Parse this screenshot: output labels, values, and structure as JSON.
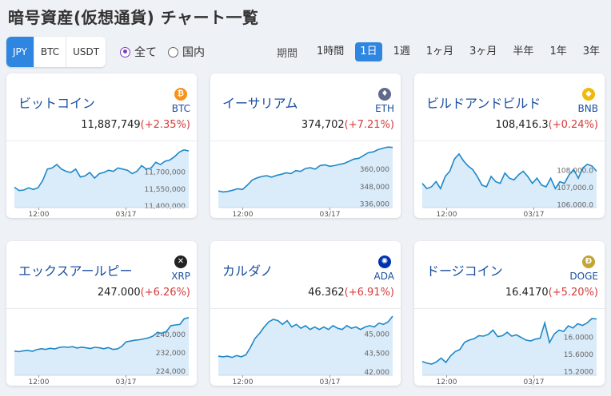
{
  "page_title": "暗号資産(仮想通貨) チャート一覧",
  "currency_tabs": [
    {
      "label": "JPY",
      "active": true
    },
    {
      "label": "BTC",
      "active": false
    },
    {
      "label": "USDT",
      "active": false
    }
  ],
  "filter_radios": [
    {
      "label": "全て",
      "checked": true
    },
    {
      "label": "国内",
      "checked": false
    }
  ],
  "period_label": "期間",
  "periods": [
    {
      "label": "1時間",
      "active": false
    },
    {
      "label": "1日",
      "active": true
    },
    {
      "label": "1週",
      "active": false
    },
    {
      "label": "1ヶ月",
      "active": false
    },
    {
      "label": "3ヶ月",
      "active": false
    },
    {
      "label": "半年",
      "active": false
    },
    {
      "label": "1年",
      "active": false
    },
    {
      "label": "3年",
      "active": false
    }
  ],
  "colors": {
    "accent": "#2f86e0",
    "line": "#1e88c8",
    "fill": "#d4e8f8",
    "change_up": "#d63b3b"
  },
  "cards": [
    {
      "name": "ビットコイン",
      "symbol": "BTC",
      "icon": "bitcoin-icon",
      "icon_color": "#f7931a",
      "icon_glyph": "₿",
      "price": "11,887,749",
      "change": "(+2.35%)",
      "chart_data": {
        "type": "area",
        "x_ticks": [
          "12:00",
          "03/17"
        ],
        "y_ticks": [
          "11,700,000",
          "11,550,000",
          "11,400,000"
        ],
        "ylim": [
          11380000,
          11930000
        ],
        "values": [
          11560000,
          11530000,
          11535000,
          11555000,
          11540000,
          11555000,
          11620000,
          11720000,
          11730000,
          11760000,
          11720000,
          11700000,
          11690000,
          11720000,
          11650000,
          11660000,
          11690000,
          11640000,
          11680000,
          11690000,
          11710000,
          11700000,
          11730000,
          11720000,
          11710000,
          11680000,
          11700000,
          11750000,
          11720000,
          11730000,
          11780000,
          11760000,
          11790000,
          11800000,
          11830000,
          11870000,
          11890000,
          11880000
        ]
      }
    },
    {
      "name": "イーサリアム",
      "symbol": "ETH",
      "icon": "ethereum-icon",
      "icon_color": "#5f6b8a",
      "icon_glyph": "♦",
      "price": "374,702",
      "change": "(+7.21%)",
      "chart_data": {
        "type": "area",
        "x_ticks": [
          "12:00",
          "03/17"
        ],
        "y_ticks": [
          "360,000",
          "348,000",
          "336,000"
        ],
        "ylim": [
          333000,
          376000
        ],
        "values": [
          344500,
          343800,
          344200,
          345000,
          346000,
          345500,
          348500,
          352000,
          353500,
          354500,
          355000,
          354000,
          355200,
          356000,
          357000,
          356500,
          358500,
          358000,
          360000,
          360500,
          359500,
          362000,
          362500,
          361500,
          362000,
          362800,
          363500,
          365000,
          366500,
          367000,
          369000,
          371000,
          371500,
          373000,
          374000,
          374800,
          374500
        ]
      }
    },
    {
      "name": "ビルドアンドビルド",
      "symbol": "BNB",
      "icon": "bnb-icon",
      "icon_color": "#f0b90b",
      "icon_glyph": "◆",
      "price": "108,416.3",
      "change": "(+0.24%)",
      "chart_data": {
        "type": "area",
        "x_ticks": [
          "12:00",
          "03/17"
        ],
        "y_ticks": [
          "108,000.0",
          "107,000.0",
          "106,000.0"
        ],
        "ylim": [
          105800,
          109400
        ],
        "values": [
          107200,
          106900,
          107000,
          107300,
          106900,
          107600,
          107900,
          108600,
          108900,
          108500,
          108200,
          108000,
          107600,
          107100,
          107000,
          107600,
          107300,
          107200,
          107800,
          107500,
          107400,
          107700,
          107900,
          107600,
          107200,
          107500,
          107100,
          107000,
          107500,
          106900,
          107300,
          107200,
          107700,
          108000,
          107500,
          108100,
          108300,
          108200,
          107900
        ]
      }
    },
    {
      "name": "エックスアールピー",
      "symbol": "XRP",
      "icon": "xrp-icon",
      "icon_color": "#222222",
      "icon_glyph": "✕",
      "price": "247.000",
      "change": "(+6.26%)",
      "chart_data": {
        "type": "area",
        "x_ticks": [
          "12:00",
          "03/17"
        ],
        "y_ticks": [
          "240,000",
          "232,000",
          "224,000"
        ],
        "ylim": [
          222000,
          249000
        ],
        "values": [
          232500,
          232200,
          232600,
          232800,
          232400,
          233100,
          233500,
          233200,
          233700,
          233400,
          234000,
          234300,
          234100,
          234400,
          233800,
          234200,
          233900,
          233600,
          234100,
          233900,
          233500,
          234000,
          233200,
          233400,
          234500,
          236500,
          236800,
          237200,
          237400,
          237800,
          238200,
          239000,
          240500,
          240200,
          241000,
          243500,
          243800,
          244000,
          246500,
          247000
        ]
      }
    },
    {
      "name": "カルダノ",
      "symbol": "ADA",
      "icon": "cardano-icon",
      "icon_color": "#0033ad",
      "icon_glyph": "✺",
      "price": "46.362",
      "change": "(+6.91%)",
      "chart_data": {
        "type": "area",
        "x_ticks": [
          "12:00",
          "03/17"
        ],
        "y_ticks": [
          "45,000",
          "43,500",
          "42,000"
        ],
        "ylim": [
          41700,
          46600
        ],
        "values": [
          43200,
          43150,
          43200,
          43100,
          43250,
          43150,
          43300,
          43900,
          44600,
          45000,
          45500,
          45900,
          46100,
          46000,
          45700,
          46000,
          45500,
          45700,
          45400,
          45600,
          45300,
          45500,
          45300,
          45500,
          45300,
          45600,
          45400,
          45300,
          45600,
          45400,
          45500,
          45300,
          45500,
          45600,
          45500,
          45800,
          45700,
          45900,
          46350
        ]
      }
    },
    {
      "name": "ドージコイン",
      "symbol": "DOGE",
      "icon": "dogecoin-icon",
      "icon_color": "#c2a633",
      "icon_glyph": "Ð",
      "price": "16.4170",
      "change": "(+5.20%)",
      "chart_data": {
        "type": "area",
        "x_ticks": [
          "12:00",
          "03/17"
        ],
        "y_ticks": [
          "16.0000",
          "15.6000",
          "15.2000"
        ],
        "ylim": [
          15100,
          16550
        ],
        "values": [
          15420,
          15380,
          15360,
          15410,
          15500,
          15400,
          15550,
          15650,
          15700,
          15870,
          15920,
          15950,
          16020,
          16010,
          16050,
          16150,
          16000,
          16020,
          16100,
          16010,
          16040,
          15980,
          15920,
          15900,
          15940,
          15960,
          16320,
          15860,
          16060,
          16150,
          16120,
          16250,
          16200,
          16300,
          16260,
          16320,
          16420,
          16410
        ]
      }
    }
  ]
}
